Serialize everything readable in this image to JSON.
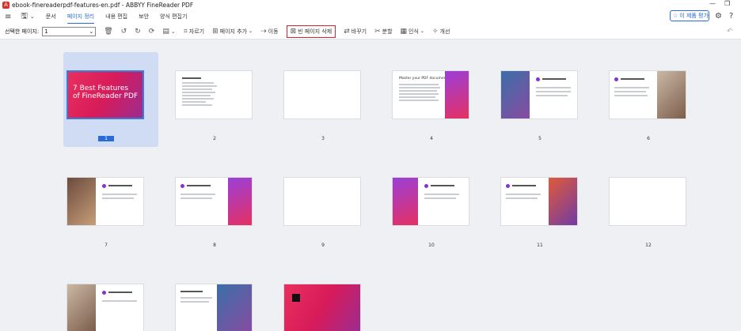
{
  "window": {
    "title": "ebook-finereaderpdf-features-en.pdf - ABBYY FineReader PDF",
    "minimize": "—",
    "restore": "❐"
  },
  "menu": {
    "items": [
      "문서",
      "페이지 정리",
      "내용 편집",
      "보안",
      "양식 편집기"
    ],
    "active_index": 1,
    "rate_label": "이 제품 평가"
  },
  "toolbar": {
    "selected_pages_label": "선택한 페이지:",
    "selected_pages_value": "1",
    "crop": "자르기",
    "add_page": "페이지 추가",
    "move": "이동",
    "delete_blank": "빈 페이지 삭제",
    "replace": "바꾸기",
    "split": "분할",
    "recognize": "인식",
    "improve": "개선"
  },
  "pages": {
    "numbers": [
      "1",
      "2",
      "3",
      "4",
      "5",
      "6",
      "7",
      "8",
      "9",
      "10",
      "11",
      "12"
    ],
    "selected": 1,
    "cover_title_1": "7 Best Features",
    "cover_title_2": "of FineReader PDF",
    "p4_title": "Master your PDF documents"
  },
  "colors": {
    "accent": "#2b6bd6",
    "highlight": "#d9232d",
    "brand": "#e8305e",
    "purple": "#9b3fd8"
  }
}
